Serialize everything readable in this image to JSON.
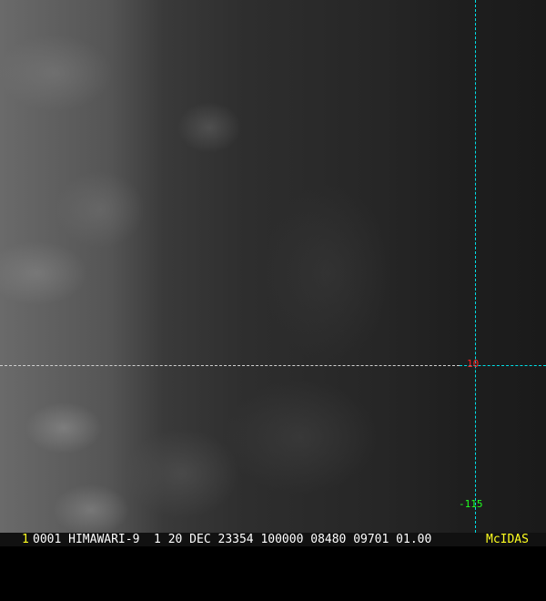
{
  "image": {
    "type": "satellite-visible-imagery",
    "satellite": "HIMAWARI-9"
  },
  "overlay": {
    "latitude_label": "10",
    "longitude_label": "-115",
    "grid_color": "#00e0e8",
    "lat_label_color": "#ff2020",
    "lon_label_color": "#20ff20"
  },
  "footer": {
    "frame_number": "1",
    "header": "0001 HIMAWARI-9  1 20 DEC 23354 100000 08480 09701 01.00",
    "brand": "McIDAS"
  }
}
